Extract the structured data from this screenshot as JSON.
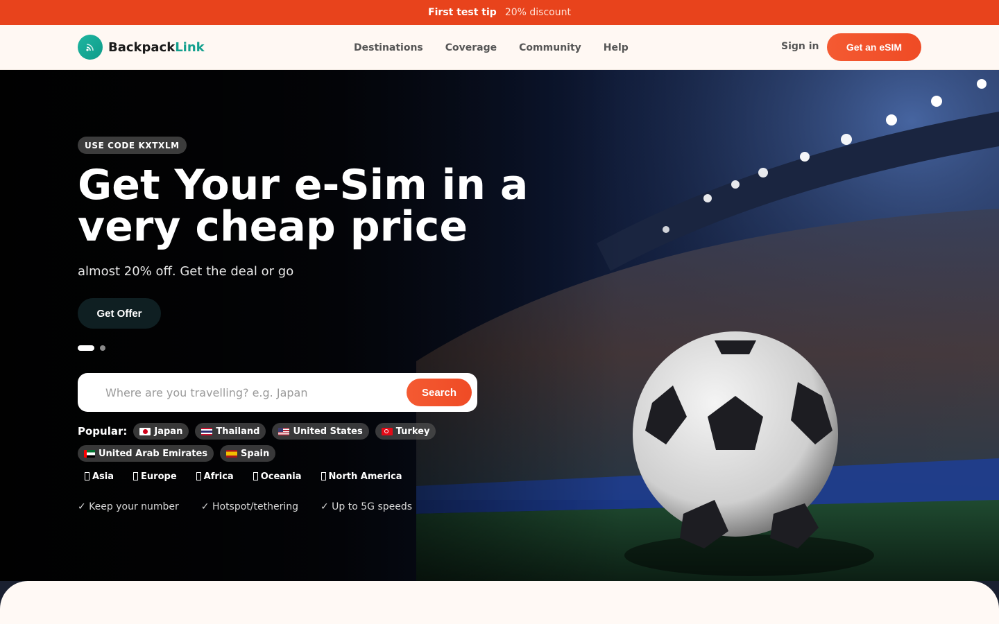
{
  "promo": {
    "title": "First test tip",
    "discount": "20% discount"
  },
  "brand": {
    "name_part1": "Backpack",
    "name_part2": "Link",
    "accent_color": "#14a08e"
  },
  "nav": {
    "links": [
      "Destinations",
      "Coverage",
      "Community",
      "Help"
    ],
    "sign_in": "Sign in",
    "cta": "Get an eSIM"
  },
  "hero": {
    "badge": "USE CODE KXTXLM",
    "title": "Get Your e-Sim in a very cheap price",
    "subtitle": "almost 20% off. Get the deal or go",
    "offer_button": "Get Offer",
    "carousel": {
      "slides": 2,
      "active": 1
    }
  },
  "search": {
    "placeholder": "Where are you travelling? e.g. Japan",
    "button": "Search"
  },
  "popular": {
    "label": "Popular:",
    "countries": [
      "Japan",
      "Thailand",
      "United States",
      "Turkey",
      "United Arab Emirates",
      "Spain"
    ]
  },
  "regions": [
    "Asia",
    "Europe",
    "Africa",
    "Oceania",
    "North America"
  ],
  "features": [
    "✓ Keep your number",
    "✓ Hotspot/tethering",
    "✓ Up to 5G speeds"
  ],
  "colors": {
    "promo_bg": "#e8431c",
    "cta": "#ef4b25"
  }
}
